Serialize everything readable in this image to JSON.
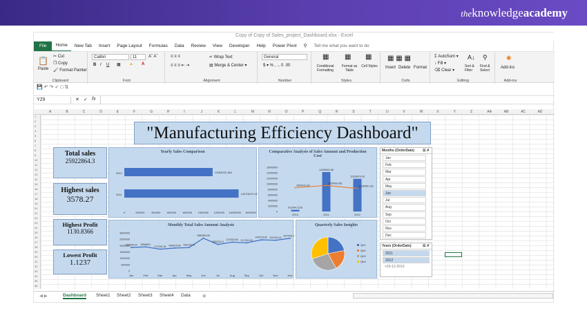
{
  "brand": {
    "the": "the",
    "knowledge": "knowledge",
    "academy": "academy"
  },
  "window": {
    "doc_title": "Copy of Copy of Sales_project_Dashboard.xlsx - Excel"
  },
  "ribbon_tabs": [
    "File",
    "Home",
    "New Tab",
    "Insert",
    "Page Layout",
    "Formulas",
    "Data",
    "Review",
    "View",
    "Developer",
    "Help",
    "Power Pivot",
    "Tell me what you want to do"
  ],
  "ribbon": {
    "clipboard": {
      "paste": "Paste",
      "cut": "Cut",
      "copy": "Copy",
      "painter": "Format Painter",
      "label": "Clipboard"
    },
    "font": {
      "name": "Calibri",
      "size": "11",
      "label": "Font"
    },
    "alignment": {
      "wrap": "Wrap Text",
      "merge": "Merge & Center",
      "label": "Alignment"
    },
    "number": {
      "format": "General",
      "label": "Number"
    },
    "styles": {
      "cond": "Conditional Formatting",
      "table": "Format as Table",
      "cell": "Cell Styles",
      "label": "Styles"
    },
    "cells": {
      "insert": "Insert",
      "delete": "Delete",
      "format": "Format",
      "label": "Cells"
    },
    "editing": {
      "autosum": "AutoSum",
      "fill": "Fill",
      "clear": "Clear",
      "sort": "Sort & Filter",
      "find": "Find & Select",
      "label": "Editing"
    },
    "addins": {
      "addins": "Add-ins",
      "label": "Add-ins"
    }
  },
  "formula_bar": {
    "name_box": "Y29",
    "fx": "fx"
  },
  "columns": [
    "A",
    "B",
    "C",
    "D",
    "E",
    "F",
    "G",
    "H",
    "I",
    "J",
    "K",
    "L",
    "M",
    "N",
    "O",
    "P",
    "Q",
    "R",
    "S",
    "T",
    "U",
    "V",
    "W",
    "X",
    "Y",
    "Z",
    "AA",
    "AB",
    "AC",
    "AD"
  ],
  "dashboard_title": "\"Manufacturing Efficiency Dashboard\"",
  "kpis": [
    {
      "label": "Total sales",
      "value": "25922864.3"
    },
    {
      "label": "Highest sales",
      "value": "3578.27"
    },
    {
      "label": "Highest Profit",
      "value": "1130.8366"
    },
    {
      "label": "Lowest Profit",
      "value": "1.1237"
    }
  ],
  "charts": {
    "yearly": {
      "title": "Yearly Sales Comparison"
    },
    "comparative": {
      "title": "Comparative Analysis of Sales Amount and Production Cost"
    },
    "monthly": {
      "title": "Monthly Total Sales Amount Analysis"
    },
    "quarterly": {
      "title": "Quarterly Sales Insights"
    }
  },
  "chart_data": [
    {
      "type": "bar",
      "title": "Yearly Sales Comparison",
      "categories": [
        "2012",
        "2011"
      ],
      "values": [
        11183031.384,
        14470679.043
      ],
      "data_labels": [
        "11183031.384",
        "14470679.043"
      ],
      "xticks": [
        "0",
        "200000",
        "400000",
        "600000",
        "800000",
        "1000000",
        "1200000",
        "14000000",
        "1600000"
      ],
      "xlim": [
        0,
        16000000
      ]
    },
    {
      "type": "bar",
      "title": "Comparative Analysis of Sales Amount and Production Cost",
      "categories": [
        "2010",
        "2011",
        "2012"
      ],
      "series": [
        {
          "values": [
            611644.1228,
            14255051.86,
            11818470.39
          ],
          "labels": [
            "611644.1228",
            "14255051.86",
            "11818470.39"
          ]
        },
        {
          "values": [
            8604310.34,
            9425456.082,
            8328956.138
          ],
          "labels": [
            "8604310.34",
            "9425456.082",
            "8328956.138"
          ]
        }
      ],
      "yticks": [
        "0",
        "2000000",
        "4000000",
        "6000000",
        "8000000",
        "10000000",
        "12000000",
        "14000000",
        "16000000"
      ],
      "ylim": [
        0,
        16000000
      ]
    },
    {
      "type": "line",
      "title": "Monthly Total Sales Amount Analysis",
      "categories": [
        "Jan",
        "Feb",
        "Mar",
        "Apr",
        "May",
        "Jun",
        "Jul",
        "Aug",
        "Sep",
        "Oct",
        "Nov",
        "Dec"
      ],
      "values": [
        1850878.04,
        1894658.1,
        1717351.84,
        1804615.68,
        1841136.78,
        2580389.618,
        2092025.11,
        2270020.65,
        2217621.89,
        2449733.83,
        2420102.61,
        2574795.413
      ],
      "data_labels": [
        "1850878.04",
        "1894658.1",
        "1717351.84",
        "1804615.68",
        "1841136.78",
        "2580389.618",
        "2092025.11",
        "2270020.65",
        "2217621.89",
        "2449733.83",
        "2420102.61",
        "2574795.413"
      ],
      "yticks": [
        "0",
        "500000",
        "1000000",
        "1500000",
        "2000000",
        "2500000",
        "3000000"
      ],
      "ylim": [
        0,
        3000000
      ]
    },
    {
      "type": "pie",
      "title": "Quarterly Sales Insights",
      "categories": [
        "Qtr1",
        "Qtr2",
        "Qtr3",
        "Qtr4"
      ],
      "values": [
        22,
        20,
        28,
        30
      ],
      "colors": [
        "#4472c4",
        "#ed7d31",
        "#a5a5a5",
        "#ffc000"
      ]
    }
  ],
  "slicers": {
    "months": {
      "header": "Months (OrderDate)",
      "items": [
        "Jan",
        "Feb",
        "Mar",
        "Apr",
        "May",
        "Jun",
        "Jul",
        "Aug",
        "Sep",
        "Oct",
        "Nov",
        "Dec"
      ],
      "selected": "Jun"
    },
    "years": {
      "header": "Years (OrderDate)",
      "items": [
        "2011",
        "2012",
        "<29-12-2010"
      ]
    }
  },
  "sheet_tabs": [
    "Dashboard",
    "Sheet1",
    "Sheet2",
    "Sheet3",
    "Sheet4",
    "Data"
  ],
  "colors": {
    "excel_green": "#217346",
    "panel": "#c5d9ee",
    "bar": "#4472c4",
    "line": "#ed7d31"
  }
}
